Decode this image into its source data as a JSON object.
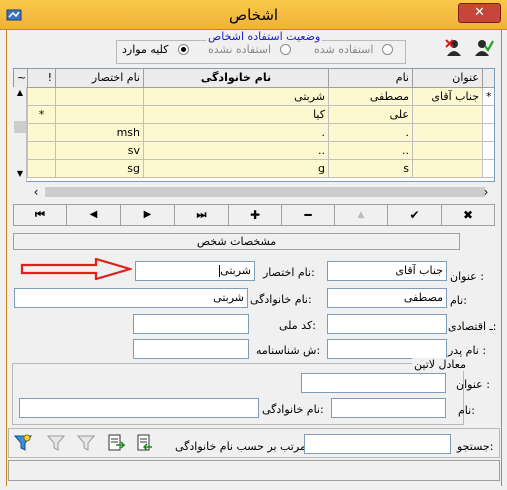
{
  "window": {
    "title": "اشخاص",
    "close_label": "✕"
  },
  "usage_status": {
    "title": "وضعیت استفاده اشخاص",
    "options": [
      {
        "label": "استفاده شده",
        "selected": false
      },
      {
        "label": "استفاده نشده",
        "selected": false
      },
      {
        "label": "کلیه موارد",
        "selected": true
      }
    ]
  },
  "toolbar_icons": [
    "user-remove-icon",
    "user-accept-icon"
  ],
  "grid": {
    "columns": {
      "title": "عنوان",
      "name": "نام",
      "family": "نام خانوادگی",
      "abbr": "نام اختصار",
      "excl": "!",
      "tilde": "~"
    },
    "rows": [
      {
        "indicator": "*",
        "title": "جناب آقای",
        "name": "مصطفی",
        "family": "شربتی",
        "abbr": "",
        "excl": ""
      },
      {
        "indicator": "",
        "title": "",
        "name": "علی",
        "family": "کیا",
        "abbr": "",
        "excl": "*"
      },
      {
        "indicator": "",
        "title": "",
        "name": ".",
        "family": ".",
        "abbr": "msh",
        "excl": ""
      },
      {
        "indicator": "",
        "title": "",
        "name": "..",
        "family": "..",
        "abbr": "sv",
        "excl": ""
      },
      {
        "indicator": "",
        "title": "",
        "name": "s",
        "family": "g",
        "abbr": "sg",
        "excl": ""
      }
    ]
  },
  "navigator": {
    "buttons": [
      {
        "name": "nav-first-button",
        "glyph": "⏮"
      },
      {
        "name": "nav-prior-button",
        "glyph": "◀"
      },
      {
        "name": "nav-next-button",
        "glyph": "▶"
      },
      {
        "name": "nav-last-button",
        "glyph": "⏭"
      },
      {
        "name": "nav-insert-button",
        "glyph": "✚"
      },
      {
        "name": "nav-delete-button",
        "glyph": "━"
      },
      {
        "name": "nav-edit-button",
        "glyph": "▲"
      },
      {
        "name": "nav-post-button",
        "glyph": "✔"
      },
      {
        "name": "nav-cancel-button",
        "glyph": "✖"
      }
    ]
  },
  "details": {
    "header": "مشخصات شخص",
    "title_label": "عنوان :",
    "title_value": "جناب آقای",
    "abbr_label": "نام اختصار:",
    "abbr_value": "شربتی",
    "name_label": "نام:",
    "name_value": "مصطفی",
    "family_label": "نام خانوادگی:",
    "family_value": "شربتی",
    "economic_label": "ـ اقتصادی:",
    "economic_value": "",
    "national_label": "کد ملی:",
    "national_value": "",
    "father_label": "نام پدر :",
    "father_value": "",
    "idcard_label": "ش شناسنامه:",
    "idcard_value": "",
    "latin_group": "معادل لاتین",
    "latin_title_label": "عنوان :",
    "latin_title_value": "",
    "latin_name_label": "نام:",
    "latin_name_value": "",
    "latin_family_label": "نام خانوادگی:",
    "latin_family_value": ""
  },
  "search": {
    "label": "جستجو:",
    "value": "",
    "sort_label": "مرتب بر حسب نام خانوادگی",
    "sort_value": ""
  },
  "bottom_icons": [
    "filter-icon",
    "filter-clear-icon",
    "filter-off-icon",
    "export-icon",
    "import-icon"
  ],
  "colors": {
    "titlebar": "#f4bb3f",
    "grid_row_bg": "#fdf8cf",
    "arrow": "#e0201a",
    "blue_text": "#1c1cc9"
  }
}
